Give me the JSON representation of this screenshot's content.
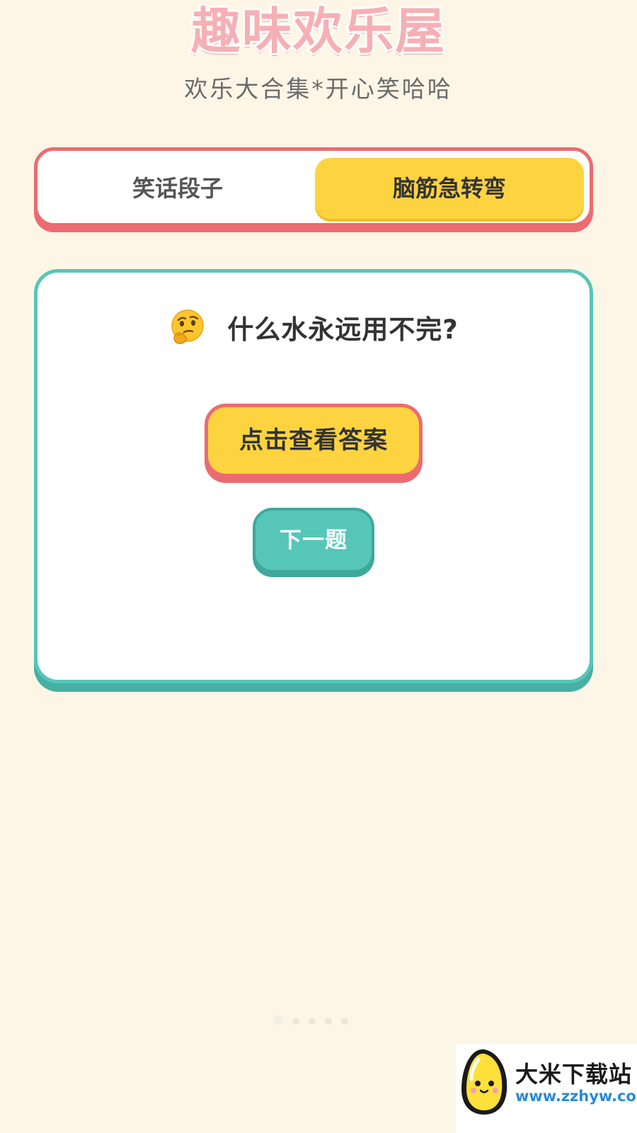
{
  "header": {
    "title": "趣味欢乐屋",
    "subtitle": "欢乐大合集*开心笑哈哈"
  },
  "tabs": [
    {
      "label": "笑话段子",
      "active": false
    },
    {
      "label": "脑筋急转弯",
      "active": true
    }
  ],
  "card": {
    "icon": "thinking-face-icon",
    "question": "什么水永远用不完?",
    "answer_button_label": "点击查看答案",
    "next_button_label": "下一题"
  },
  "pager": {
    "count": 5,
    "active_index": 0
  },
  "watermark": {
    "name": "大米下载站",
    "url": "www.zzhyw.com"
  },
  "colors": {
    "background": "#fdf6e6",
    "title_pink": "#f6b0b5",
    "accent_red": "#ec6b70",
    "accent_yellow": "#fdd33f",
    "accent_teal": "#56c6b9"
  }
}
